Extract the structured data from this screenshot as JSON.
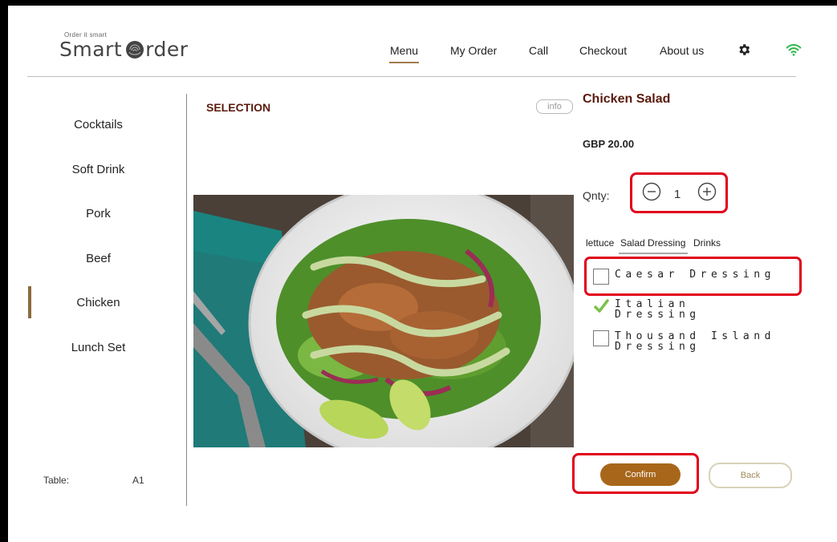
{
  "header": {
    "tagline": "Order it smart",
    "brand_part1": "Smart",
    "brand_part2": "rder",
    "nav": [
      "Menu",
      "My Order",
      "Call",
      "Checkout",
      "About us"
    ],
    "active_nav": "Menu",
    "icons": [
      "gear-icon",
      "wifi-icon"
    ],
    "wifi_color": "#2db84a"
  },
  "sidebar": {
    "items": [
      "Cocktails",
      "Soft Drink",
      "Pork",
      "Beef",
      "Chicken",
      "Lunch Set"
    ],
    "selected": "Chicken",
    "table_label": "Table:",
    "table_value": "A1"
  },
  "main": {
    "section_title": "SELECTION",
    "info_label": "info"
  },
  "detail": {
    "title": "Chicken Salad",
    "price": "GBP 20.00",
    "qty_label": "Qnty:",
    "qty_value": "1",
    "tabs": [
      "lettuce",
      "Salad Dressing",
      "Drinks"
    ],
    "active_tab": "Salad Dressing",
    "options": [
      {
        "label": "Caesar Dressing",
        "checked": false
      },
      {
        "label": "Italian Dressing",
        "checked": true
      },
      {
        "label": "Thousand Island Dressing",
        "checked": false
      }
    ],
    "confirm_label": "Confirm",
    "back_label": "Back"
  },
  "colors": {
    "accent_brown": "#a8661a",
    "title_maroon": "#5a1a0c",
    "highlight_red": "#e0001a",
    "check_green": "#7cc04a"
  }
}
